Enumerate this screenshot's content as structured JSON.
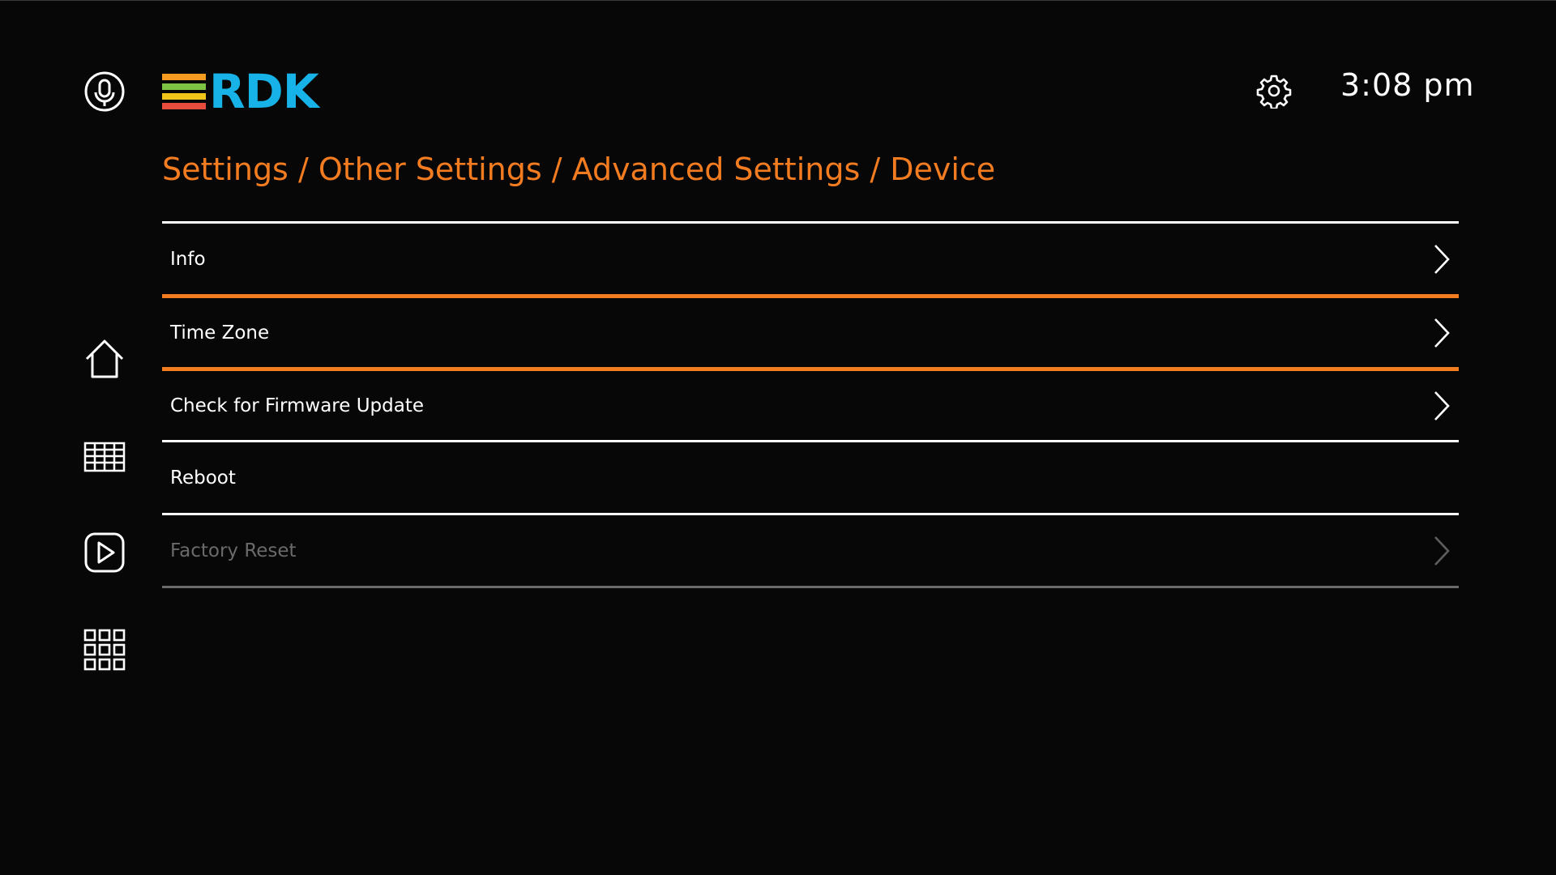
{
  "header": {
    "logo_text": "RDK",
    "logo_bar_colors": [
      "#f39c1f",
      "#7dc242",
      "#f0c419",
      "#e84c3d"
    ],
    "clock": "3:08 pm",
    "icons": {
      "voice": "microphone-icon",
      "settings": "gear-icon"
    }
  },
  "breadcrumb": "Settings / Other Settings / Advanced Settings / Device",
  "rail": [
    {
      "icon": "home-icon"
    },
    {
      "icon": "tv-guide-icon"
    },
    {
      "icon": "play-icon"
    },
    {
      "icon": "apps-grid-icon"
    }
  ],
  "menu": {
    "items": [
      {
        "label": "Info",
        "has_chevron": true,
        "enabled": true
      },
      {
        "label": "Time Zone",
        "has_chevron": true,
        "enabled": true,
        "focused": true
      },
      {
        "label": "Check for Firmware Update",
        "has_chevron": true,
        "enabled": true
      },
      {
        "label": "Reboot",
        "has_chevron": false,
        "enabled": true
      },
      {
        "label": "Factory Reset",
        "has_chevron": true,
        "enabled": false
      }
    ]
  },
  "colors": {
    "accent": "#f47c20",
    "logo_blue": "#17b3e8",
    "background": "#070707",
    "disabled_text": "#6a6a6a"
  }
}
